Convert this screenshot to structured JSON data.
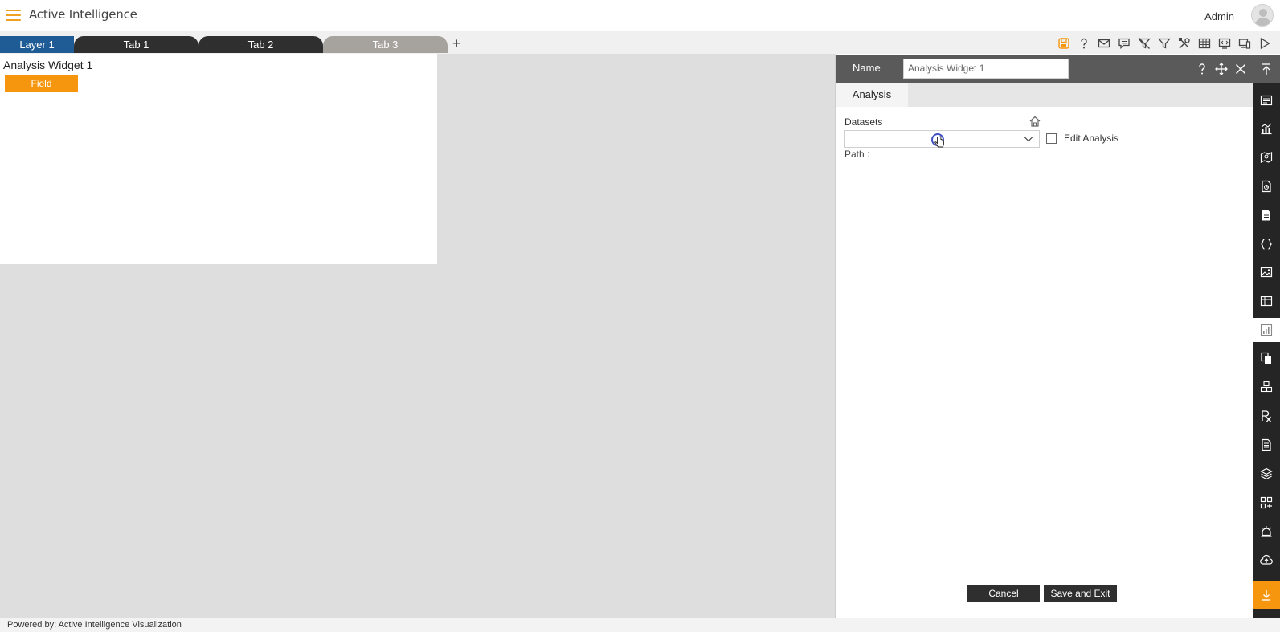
{
  "header": {
    "app_title": "Active Intelligence",
    "user_name": "Admin"
  },
  "tabs": {
    "layer_label": "Layer 1",
    "items": [
      "Tab 1",
      "Tab 2",
      "Tab 3"
    ],
    "add_label": "+"
  },
  "toolbar": {
    "icons": [
      "save-icon",
      "help-icon",
      "mail-icon",
      "comment-icon",
      "clear-filter-icon",
      "filter-icon",
      "tools-icon",
      "table-icon",
      "embed-icon",
      "devices-icon",
      "play-icon"
    ],
    "save_color": "#f6960f"
  },
  "widget": {
    "title": "Analysis Widget 1",
    "field_label": "Field"
  },
  "panel": {
    "name_label": "Name",
    "name_value": "Analysis Widget 1",
    "tab_label": "Analysis",
    "datasets_label": "Datasets",
    "edit_analysis_label": "Edit Analysis",
    "edit_analysis_checked": false,
    "path_label": "Path :",
    "cancel_label": "Cancel",
    "save_exit_label": "Save and Exit"
  },
  "rail": {
    "icons": [
      "collapse-top-icon",
      "list-icon",
      "chart-icon",
      "map-icon",
      "doc-icon",
      "page-icon",
      "code-icon",
      "image-icon",
      "table-icon",
      "analysis-icon",
      "copy-icon",
      "cubes-icon",
      "rx-icon",
      "report-icon",
      "layers-icon",
      "apps-add-icon",
      "alarm-icon",
      "cloud-upload-icon",
      "download-icon"
    ],
    "active_icon": "analysis-icon",
    "accent": "#f6960f"
  },
  "footer": {
    "text": "Powered by: Active Intelligence Visualization"
  },
  "colors": {
    "layer_tab": "#1f5b94",
    "dark_tab": "#2f2f2f",
    "inactive_tab": "#a6a39f",
    "accent": "#f6960f",
    "canvas": "#dedede"
  }
}
